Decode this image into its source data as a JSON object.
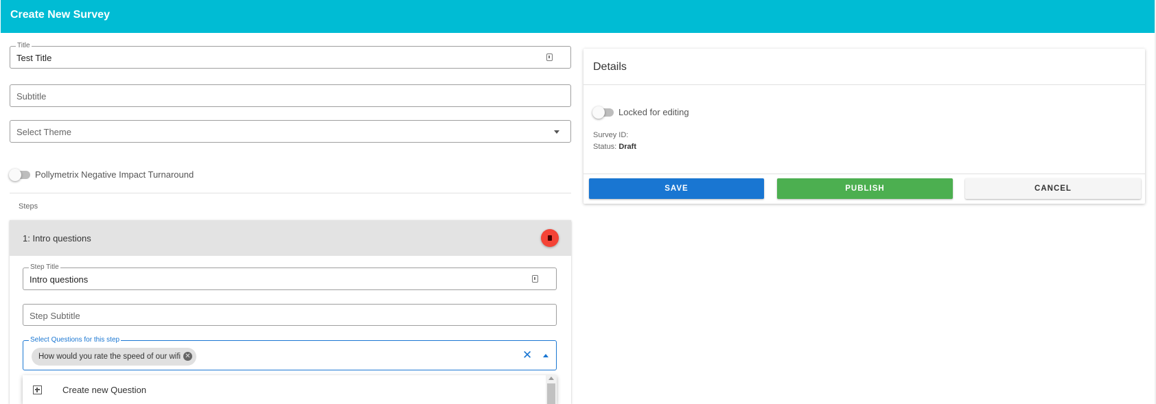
{
  "header": {
    "title": "Create New Survey"
  },
  "form": {
    "title_field": {
      "label": "Title",
      "value": "Test Title"
    },
    "subtitle_field": {
      "placeholder": "Subtitle"
    },
    "theme_select": {
      "placeholder": "Select Theme"
    },
    "pollymetrix_toggle": {
      "label": "Pollymetrix Negative Impact Turnaround",
      "on": false
    },
    "steps_label": "Steps"
  },
  "step": {
    "header_label": "1: Intro questions",
    "title_field": {
      "label": "Step Title",
      "value": "Intro questions"
    },
    "subtitle_field": {
      "placeholder": "Step Subtitle"
    },
    "questions_select": {
      "label": "Select Questions for this step",
      "chips": [
        "How would you rate the speed of our wifi"
      ]
    },
    "dropdown": {
      "create_label": "Create new Question"
    }
  },
  "details": {
    "title": "Details",
    "locked_label": "Locked for editing",
    "survey_id_label": "Survey ID:",
    "survey_id_value": "",
    "status_label": "Status:",
    "status_value": "Draft",
    "buttons": {
      "save": "SAVE",
      "publish": "PUBLISH",
      "cancel": "CANCEL"
    }
  },
  "colors": {
    "header": "#00bcd4",
    "save": "#1976d2",
    "publish": "#4caf50",
    "delete": "#f44336"
  }
}
